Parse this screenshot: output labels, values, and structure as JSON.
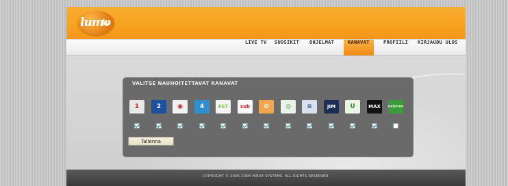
{
  "logo": {
    "main": "lumo",
    "suffix": "tv"
  },
  "nav": [
    {
      "label": "LIVE TV",
      "active": false
    },
    {
      "label": "SUOSIKIT",
      "active": false
    },
    {
      "label": "OHJELMAT",
      "active": false
    },
    {
      "label": "KANAVAT",
      "active": true
    },
    {
      "label": "PROFIILI",
      "active": false
    },
    {
      "label": "KIRJAUDU ULOS",
      "active": false
    }
  ],
  "panel": {
    "title": "VALITSE NAUHOITETTAVAT KANAVAT",
    "save_label": "Tallenna",
    "channels": [
      {
        "icon": "tv1-logo-icon",
        "text": "1",
        "bg": "#e8e8e8",
        "fg": "#d0262b",
        "checked": true
      },
      {
        "icon": "tv2-logo-icon",
        "text": "2",
        "bg": "#1d4fa0",
        "fg": "#ffffff",
        "checked": true
      },
      {
        "icon": "mtv3-logo-icon",
        "text": "◉",
        "bg": "#f2f2f2",
        "fg": "#c0262b",
        "checked": true
      },
      {
        "icon": "nelonen-logo-icon",
        "text": "4",
        "bg": "#2d8fd0",
        "fg": "#ffffff",
        "checked": true
      },
      {
        "icon": "fst-logo-icon",
        "text": "FST",
        "bg": "#f4f4f4",
        "fg": "#7cc043",
        "checked": true
      },
      {
        "icon": "subtv-logo-icon",
        "text": "sub",
        "bg": "#fafafa",
        "fg": "#d0262b",
        "checked": true
      },
      {
        "icon": "jim-orange-logo-icon",
        "text": "✿",
        "bg": "#f2a54a",
        "fg": "#ffffff",
        "checked": true
      },
      {
        "icon": "urheilu-logo-icon",
        "text": "◎",
        "bg": "#e8f4e8",
        "fg": "#3c9a3c",
        "checked": true
      },
      {
        "icon": "tvviisi-logo-icon",
        "text": "≡",
        "bg": "#d8e2ef",
        "fg": "#1d4f8a",
        "checked": true
      },
      {
        "icon": "jim-logo-icon",
        "text": "JIM",
        "bg": "#1e2f55",
        "fg": "#ffffff",
        "checked": true
      },
      {
        "icon": "urheilu2-logo-icon",
        "text": "U",
        "bg": "#eaf5e4",
        "fg": "#2e8b2e",
        "checked": true
      },
      {
        "icon": "max-logo-icon",
        "text": "MAX",
        "bg": "#111111",
        "fg": "#ffffff",
        "checked": true
      },
      {
        "icon": "nelonen-extra-logo-icon",
        "text": "nelonen",
        "bg": "#3c9c3c",
        "fg": "#d9f2d0",
        "checked": false
      }
    ]
  },
  "footer": {
    "copyright": "COPYRIGHT © 2005-2006 HIBOX SYSTEMS. ALL RIGHTS RESERVED."
  },
  "colors": {
    "accent": "#f7a21f",
    "panel": "#6a6a6a"
  }
}
